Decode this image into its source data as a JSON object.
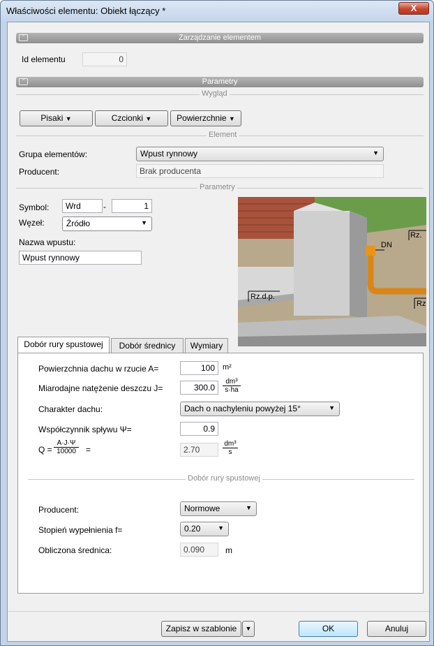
{
  "window": {
    "title": "Właściwości elementu: Obiekt łączący *",
    "close": "X"
  },
  "section_manage": {
    "title": "Zarządzanie elementem",
    "id_label": "Id elementu",
    "id_value": "0"
  },
  "section_params": {
    "title": "Parametry"
  },
  "wyglad": {
    "title": "Wygląd",
    "pisaki": "Pisaki",
    "czcionki": "Czcionki",
    "powierzchnie": "Powierzchnie"
  },
  "element": {
    "title": "Element",
    "group_label": "Grupa elementów:",
    "group_value": "Wpust rynnowy",
    "producer_label": "Producent:",
    "producer_value": "Brak producenta"
  },
  "parametry": {
    "title": "Parametry",
    "symbol_label": "Symbol:",
    "symbol_value": "Wrd",
    "dash": "-",
    "symbol_num": "1",
    "node_label": "Węzeł:",
    "node_value": "Źródło",
    "name_label": "Nazwa wpustu:",
    "name_value": "Wpust rynnowy"
  },
  "image": {
    "label_rz_top": "Rz.",
    "label_dn": "DN",
    "label_rzdp": "Rz.d.p.",
    "label_rz_right": "Rz"
  },
  "tabs": [
    {
      "label": "Dobór rury spustowej"
    },
    {
      "label": "Dobór średnicy"
    },
    {
      "label": "Wymiary"
    }
  ],
  "form": {
    "area_label": "Powierzchnia dachu w rzucie A=",
    "area_value": "100",
    "area_unit": "m²",
    "rain_label": "Miarodajne natężenie deszczu J=",
    "rain_value": "300.0",
    "rain_unit_num": "dm³",
    "rain_unit_den": "s·ha",
    "roof_label": "Charakter dachu:",
    "roof_value": "Dach o nachyleniu powyżej 15°",
    "coef_label": "Współczynnik spływu Ψ=",
    "coef_value": "0.9",
    "q_label": "Q =",
    "q_num": "A·J·Ψ",
    "q_den": "10000",
    "q_eq": "=",
    "q_value": "2.70",
    "q_unit_num": "dm³",
    "q_unit_den": "s",
    "pipe_section": "Dobór rury spustowej",
    "producer_label": "Producent:",
    "producer_value": "Normowe",
    "fill_label": "Stopień wypełnienia f=",
    "fill_value": "0.20",
    "diam_label": "Obliczona średnica:",
    "diam_value": "0.090",
    "diam_unit": "m"
  },
  "footer": {
    "save_template": "Zapisz w szablonie",
    "ok": "OK",
    "cancel": "Anuluj"
  }
}
